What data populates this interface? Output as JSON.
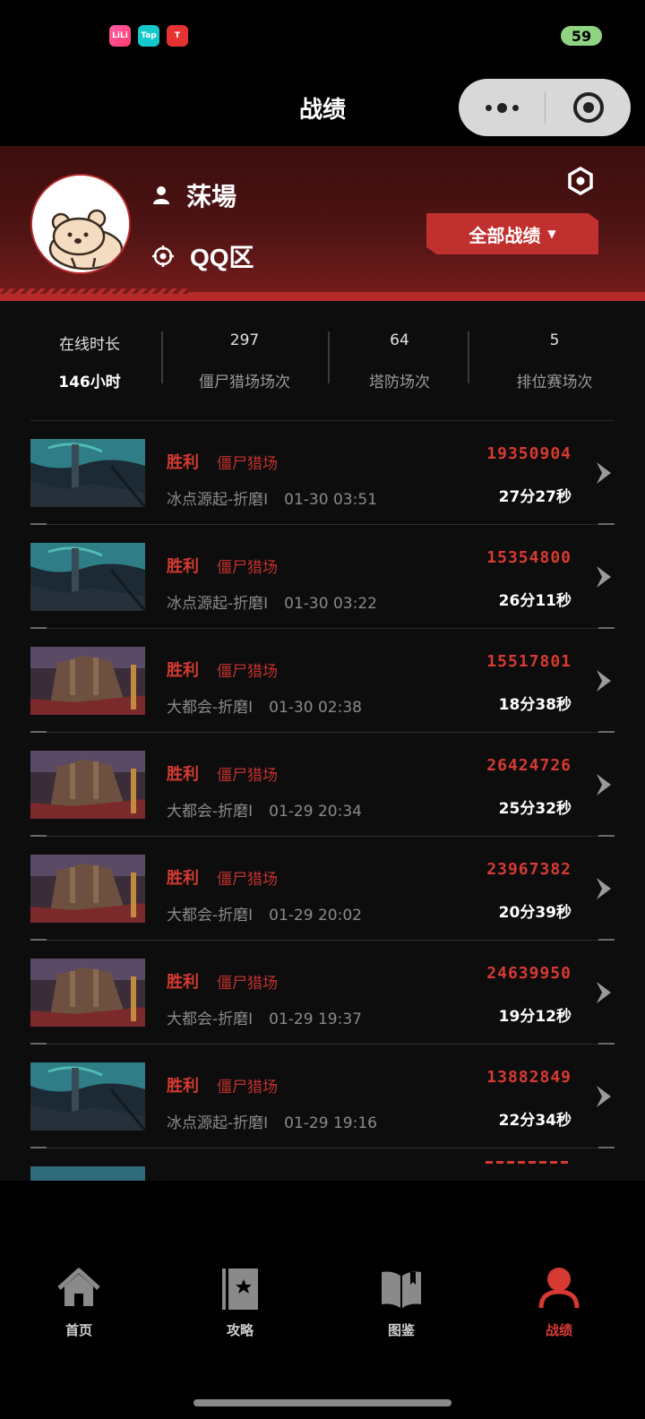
{
  "status_bar": {
    "apps": [
      "LiLi",
      "Tap",
      "T"
    ],
    "battery": "59"
  },
  "nav": {
    "title": "战绩"
  },
  "profile": {
    "name": "莯場",
    "region": "QQ区",
    "filter_label": "全部战绩"
  },
  "stats": [
    {
      "label": "在线时长",
      "value": "146小时"
    },
    {
      "value": "297",
      "label": "僵尸猎场场次"
    },
    {
      "value": "64",
      "label": "塔防场次"
    },
    {
      "value": "5",
      "label": "排位赛场次"
    }
  ],
  "records": [
    {
      "result": "胜利",
      "mode": "僵尸猎场",
      "map": "冰点源起-折磨I",
      "time": "01-30 03:51",
      "score": "19350904",
      "duration": "27分27秒",
      "thumb": "ice"
    },
    {
      "result": "胜利",
      "mode": "僵尸猎场",
      "map": "冰点源起-折磨I",
      "time": "01-30 03:22",
      "score": "15354800",
      "duration": "26分11秒",
      "thumb": "ice"
    },
    {
      "result": "胜利",
      "mode": "僵尸猎场",
      "map": "大都会-折磨I",
      "time": "01-30 02:38",
      "score": "15517801",
      "duration": "18分38秒",
      "thumb": "city"
    },
    {
      "result": "胜利",
      "mode": "僵尸猎场",
      "map": "大都会-折磨I",
      "time": "01-29 20:34",
      "score": "26424726",
      "duration": "25分32秒",
      "thumb": "city"
    },
    {
      "result": "胜利",
      "mode": "僵尸猎场",
      "map": "大都会-折磨I",
      "time": "01-29 20:02",
      "score": "23967382",
      "duration": "20分39秒",
      "thumb": "city"
    },
    {
      "result": "胜利",
      "mode": "僵尸猎场",
      "map": "大都会-折磨I",
      "time": "01-29 19:37",
      "score": "24639950",
      "duration": "19分12秒",
      "thumb": "city"
    },
    {
      "result": "胜利",
      "mode": "僵尸猎场",
      "map": "冰点源起-折磨I",
      "time": "01-29 19:16",
      "score": "13882849",
      "duration": "22分34秒",
      "thumb": "ice"
    }
  ],
  "tabs": [
    {
      "label": "首页",
      "icon": "home-icon"
    },
    {
      "label": "攻略",
      "icon": "guide-book-icon"
    },
    {
      "label": "图鉴",
      "icon": "open-book-icon"
    },
    {
      "label": "战绩",
      "icon": "person-icon",
      "active": true
    }
  ],
  "colors": {
    "accent": "#c0302e",
    "score_red": "#d63a32",
    "background": "#0d0d0d"
  }
}
